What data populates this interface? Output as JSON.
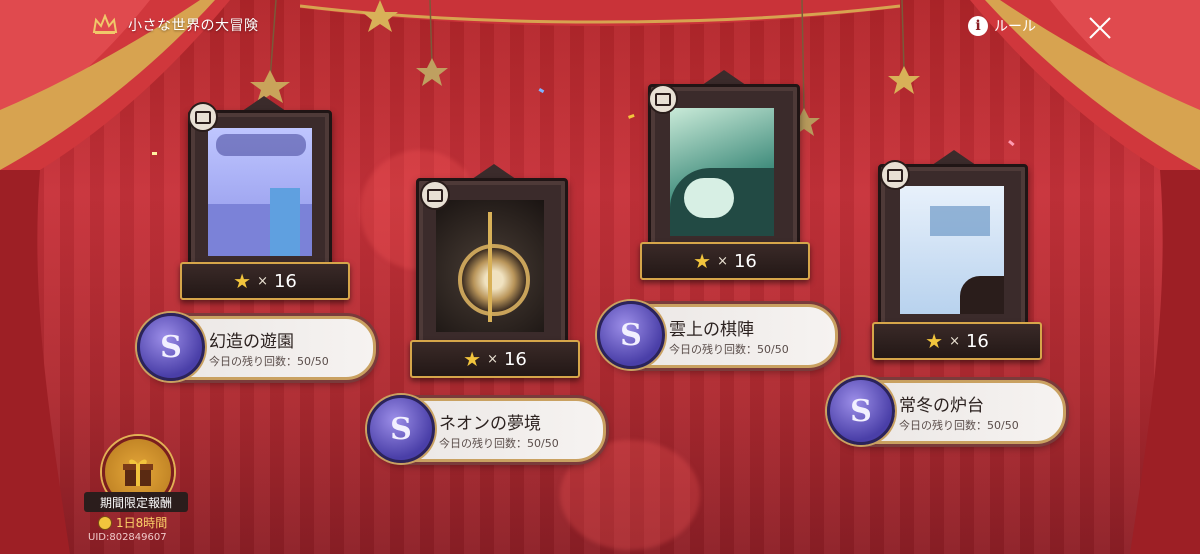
{
  "header": {
    "title": "小さな世界の大冒険",
    "rule_label": "ルール"
  },
  "stages": [
    {
      "name": "幻造の遊園",
      "remaining": "今日の残り回数：50/50",
      "stars_x": "×",
      "stars": "16",
      "icon_letter": "S"
    },
    {
      "name": "ネオンの夢境",
      "remaining": "今日の残り回数：50/50",
      "stars_x": "×",
      "stars": "16",
      "icon_letter": "S"
    },
    {
      "name": "雲上の棋陣",
      "remaining": "今日の残り回数：50/50",
      "stars_x": "×",
      "stars": "16",
      "icon_letter": "S"
    },
    {
      "name": "常冬の炉台",
      "remaining": "今日の残り回数：50/50",
      "stars_x": "×",
      "stars": "16",
      "icon_letter": "S"
    }
  ],
  "reward": {
    "label": "期間限定報酬",
    "timer": "1日8時間"
  },
  "uid": "UID:802849607",
  "icons": {
    "crown": "crown-icon",
    "info": "info-icon",
    "close": "close-icon",
    "tv": "tv-icon",
    "star": "star-icon",
    "gift": "gift-icon",
    "clock": "clock-icon"
  },
  "colors": {
    "background": "#b3252a",
    "gold": "#c9a161",
    "star": "#f2c53d",
    "frame": "#3b2b2b",
    "pill_icon": "#4a3fa8"
  }
}
